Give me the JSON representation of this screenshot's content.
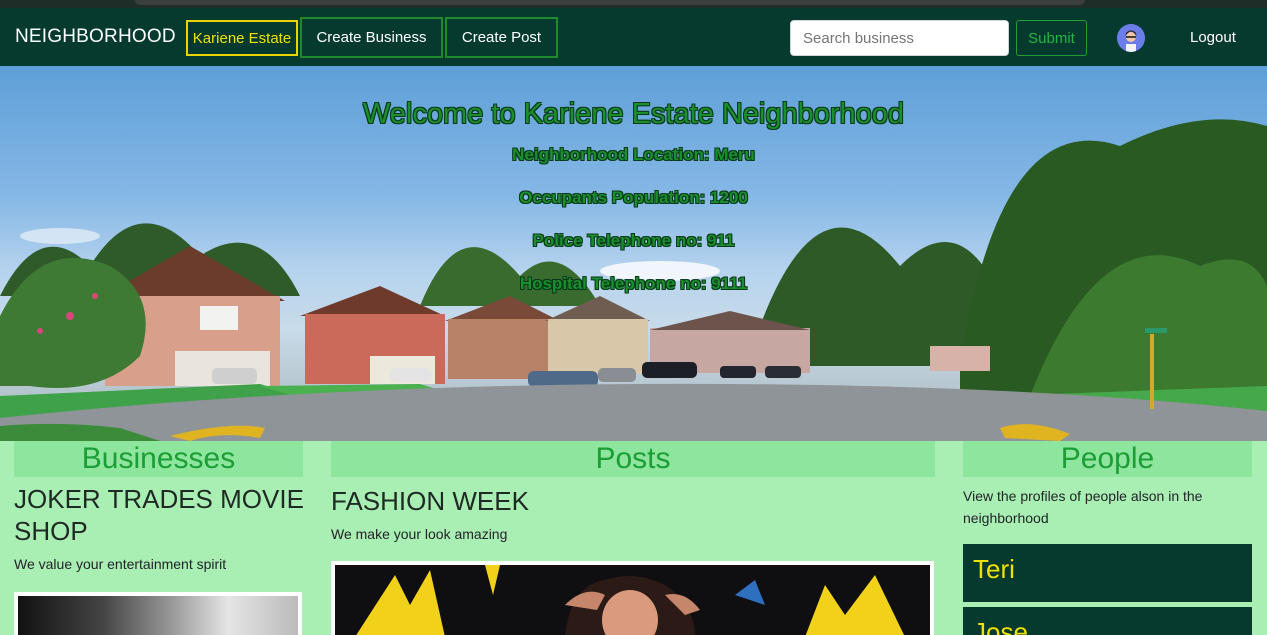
{
  "navbar": {
    "brand": "NEIGHBORHOOD",
    "links": [
      {
        "label": "Kariene Estate",
        "active": true
      },
      {
        "label": "Create Business",
        "active": false
      },
      {
        "label": "Create Post",
        "active": false
      }
    ],
    "search_placeholder": "Search business",
    "submit_label": "Submit",
    "avatar_icon": "user-avatar-icon",
    "logout_label": "Logout"
  },
  "hero": {
    "title": "Welcome to Kariene Estate Neighborhood",
    "location": "Neighborhood Location: Meru",
    "population": "Occupants Population: 1200",
    "police": "Police Telephone no: 911",
    "hospital": "Hospital Telephone no: 9111"
  },
  "businesses": {
    "heading": "Businesses",
    "items": [
      {
        "name": "JOKER TRADES MOVIE SHOP",
        "description": "We value your entertainment spirit"
      }
    ]
  },
  "posts": {
    "heading": "Posts",
    "items": [
      {
        "title": "FASHION WEEK",
        "description": "We make your look amazing"
      }
    ]
  },
  "people": {
    "heading": "People",
    "description": "View the profiles of people alson in the neighborhood",
    "items": [
      "Teri",
      "Jose"
    ]
  },
  "colors": {
    "navbar": "#063a2f",
    "page_background": "#a9eeb3",
    "heading_background": "#8ee59d",
    "accent_green": "#1b9e35",
    "active_yellow": "#f2e100"
  }
}
